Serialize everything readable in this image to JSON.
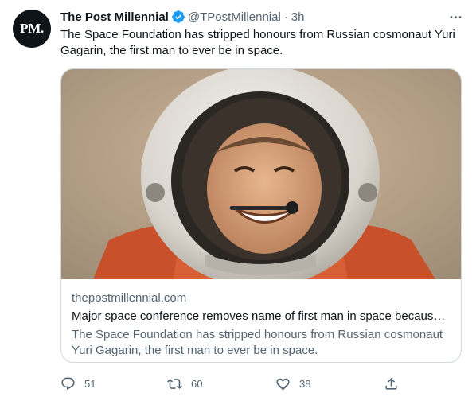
{
  "author": {
    "avatar_text": "PM.",
    "name": "The Post Millennial",
    "handle": "@TPostMillennial",
    "separator": "·",
    "time": "3h",
    "verified": true
  },
  "tweet": {
    "text": "The Space Foundation has stripped honours from Russian cosmonaut Yuri Gagarin, the first man to ever be in space."
  },
  "card": {
    "domain": "thepostmillennial.com",
    "title": "Major space conference removes name of first man in space because ...",
    "description": "The Space Foundation has stripped honours from Russian cosmonaut Yuri Gagarin, the first man to ever be in space."
  },
  "actions": {
    "replies": "51",
    "retweets": "60",
    "likes": "38"
  },
  "icons": {
    "more": "more-horizontal-icon",
    "verified": "verified-badge-icon",
    "reply": "reply-icon",
    "retweet": "retweet-icon",
    "like": "heart-icon",
    "share": "share-icon"
  },
  "colors": {
    "text": "#0f1419",
    "secondary": "#536471",
    "verified": "#1d9bf0",
    "border": "#cfd9de"
  }
}
